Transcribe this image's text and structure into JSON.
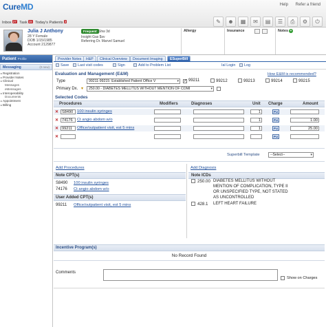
{
  "app": {
    "logo_main": "Cure",
    "logo_accent": "MD",
    "help_link": "Help",
    "refer_link": "Refer a friend",
    "quick_inbox": "Inbox",
    "quick_task": "Task",
    "quick_today": "Today's Patients",
    "badge_inbox": "27",
    "badge_task": "15",
    "badge_today": "3"
  },
  "patient": {
    "name": "Julia J Anthony",
    "age_sex": "28 Y Female",
    "dob": "DOB 1/15/1985",
    "account": "Account 2129877",
    "status_badge": "Frequent",
    "appt_line": "Shw 3d",
    "insight_line": "Insight Gas  $sv",
    "referring_line": "Referring  Dr. Marvel Samuel",
    "allergy_label": "Allergy",
    "insurance_label": "Insurance",
    "notes_label": "Notes"
  },
  "sidebar": {
    "title": "Patient",
    "title_sub": "Profile",
    "messaging": "Messaging",
    "messaging_count": "(0 new)",
    "items": [
      {
        "label": "Registration",
        "level": "top"
      },
      {
        "label": "Provider Notes",
        "level": "top"
      },
      {
        "label": "Clinical",
        "level": "top"
      },
      {
        "label": "Messages",
        "level": "sub"
      },
      {
        "label": "eMessages",
        "level": "sub"
      },
      {
        "label": "Interoperability",
        "level": "top"
      },
      {
        "label": "Documents",
        "level": "sub"
      },
      {
        "label": "Appointment",
        "level": "top"
      },
      {
        "label": "Billing",
        "level": "top"
      }
    ]
  },
  "tabs": [
    "Provider Notes",
    "H&P",
    "Clinical Overview",
    "Document Imaging",
    "ESuperBill"
  ],
  "toolbar": {
    "save": "Save",
    "last_visit": "Last visit codes",
    "sign": "Sign",
    "add_problem": "Add to Problem List",
    "ial_login": "Ial Login",
    "log": "Log"
  },
  "em": {
    "title": "Evaluation and Management (E&M)",
    "recommend_link": "How E&M is recommended?",
    "type_label": "Type",
    "type_value": "99211-99215: Established Patient Office V",
    "codes": [
      {
        "code": "99211",
        "checked": true
      },
      {
        "code": "99212",
        "checked": false
      },
      {
        "code": "99213",
        "checked": false
      },
      {
        "code": "99214",
        "checked": false
      },
      {
        "code": "99215",
        "checked": false
      }
    ],
    "primary_dx_label": "Primary Dx.",
    "primary_dx_value": "250.00 - DIABETES MELLITUS WITHOUT MENTION OF COMI"
  },
  "selected_codes": {
    "title": "Selected Codes",
    "headers": {
      "procedures": "Procedures",
      "modifiers": "Modifiers",
      "diagnoses": "Diagnoses",
      "unit": "Unit",
      "charge": "Charge",
      "amount": "Amount"
    },
    "rows": [
      {
        "code": "S8490",
        "desc": "100 insulin syringes",
        "unit": "1",
        "pu": "PU",
        "amount": ""
      },
      {
        "code": "74176",
        "desc": "Ct angio abdom w/o",
        "unit": "1",
        "pu": "PU",
        "amount": "1.00"
      },
      {
        "code": "99211",
        "desc": "Office/outpatient visit, est 5 mins",
        "unit": "1",
        "pu": "PU",
        "amount": "25.00"
      },
      {
        "code": "",
        "desc": "",
        "unit": "",
        "pu": "PU",
        "amount": ""
      }
    ]
  },
  "superbill": {
    "label": "Superbill Template",
    "select_value": "--Select--"
  },
  "procedures_panel": {
    "add_link": "Add Procedures",
    "note_title": "Note CPT(s)",
    "note_items": [
      {
        "code": "S8490",
        "desc": "100 insulin syringes"
      },
      {
        "code": "74176",
        "desc": "Ct angio abdom w/o"
      }
    ],
    "user_title": "User Added CPT(s)",
    "user_items": [
      {
        "code": "99211",
        "desc": "Office/outpatient visit, est 5 mins"
      }
    ]
  },
  "diagnosis_panel": {
    "add_link": "Add Diagnosis",
    "note_title": "Note ICDs",
    "items": [
      {
        "code": "250.00",
        "desc_lines": [
          "DIABETES MELLITUS WITHOUT",
          "MENTION OF COMPLICATION, TYPE II",
          "OR UNSPECIFIED TYPE, NOT STATED",
          "AS UNCONTROLLED"
        ]
      },
      {
        "code": "428.1",
        "desc_lines": [
          "LEFT HEART FAILURE"
        ]
      }
    ]
  },
  "incentive": {
    "title": "Incentive Program(s)",
    "empty": "No Record Found"
  },
  "comments": {
    "label": "Comments",
    "show_on_charges": "Show on Charges"
  }
}
